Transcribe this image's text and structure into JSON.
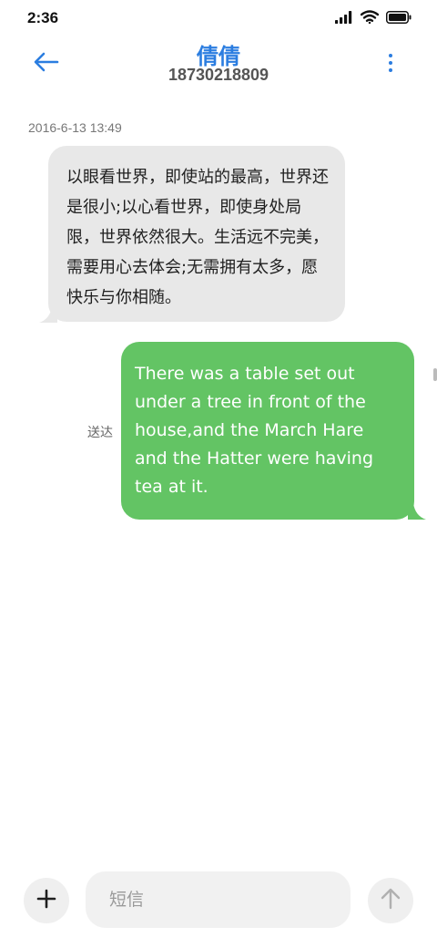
{
  "status_bar": {
    "time": "2:36",
    "icons": [
      "signal-icon",
      "wifi-icon",
      "battery-icon"
    ]
  },
  "header": {
    "back_icon": "back-arrow-icon",
    "contact_name": "倩倩",
    "contact_number": "18730218809",
    "more_icon": "more-vertical-icon"
  },
  "conversation": {
    "timestamp": "2016-6-13 13:49",
    "incoming": {
      "text": "以眼看世界，即使站的最高，世界还是很小;以心看世界，即使身处局限，世界依然很大。生活远不完美，需要用心去体会;无需拥有太多，愿快乐与你相随。"
    },
    "outgoing": {
      "text": "There was a table set out under a tree in front of the house,and the March Hare and the Hatter were having tea at it.",
      "status": "送达"
    }
  },
  "composer": {
    "add_icon": "plus-icon",
    "input_value": "",
    "input_placeholder": "短信",
    "send_icon": "send-arrow-icon"
  },
  "colors": {
    "accent": "#2b7de0",
    "incoming_bubble": "#e8e8e8",
    "outgoing_bubble": "#63c464",
    "background": "#ffffff"
  }
}
